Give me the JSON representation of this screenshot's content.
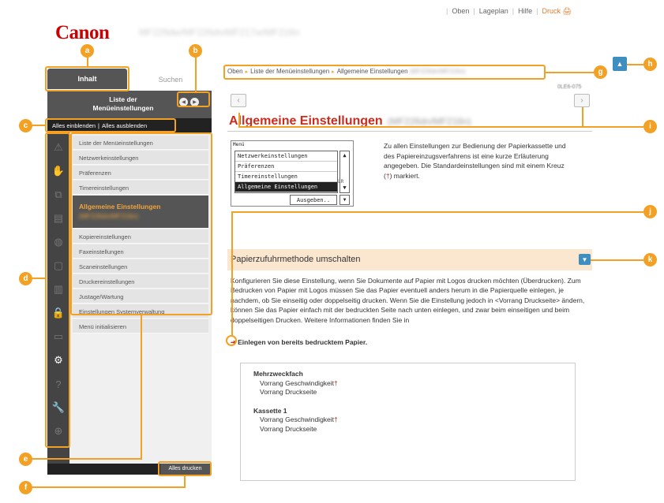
{
  "header": {
    "logo": "Canon",
    "model": "MF229dw/MF226dn/MF217w/MF216n",
    "links": [
      "Oben",
      "Lageplan",
      "Hilfe",
      "Druck"
    ]
  },
  "left": {
    "tab_contents": "Inhalt",
    "tab_search": "Suchen",
    "pane_title": "Liste der Menüeinstellungen",
    "show_all": "Alles einblenden",
    "hide_all": "Alles ausblenden",
    "menu": [
      "Liste der Menüeinstellungen",
      "Netzwerkeinstellungen",
      "Präferenzen",
      "Timereinstellungen",
      "Allgemeine Einstellungen",
      "Kopiereinstellungen",
      "Faxeinstellungen",
      "Scaneinstellungen",
      "Druckereinstellungen",
      "Justage/Wartung",
      "Einstellungen Systemverwaltung",
      "Menü initialisieren"
    ],
    "active_suffix": "(MF226dn/MF216n)",
    "print_all": "Alles drucken",
    "icons": [
      "warning-icon",
      "hand-icon",
      "machine-icon",
      "printer-icon",
      "globe-icon",
      "copy-icon",
      "scanner-icon",
      "lock-icon",
      "network-icon",
      "settings-icon",
      "help-icon",
      "wrench-icon",
      "plus-icon"
    ]
  },
  "main": {
    "breadcrumb": [
      "Oben",
      "Liste der Menüeinstellungen",
      "Allgemeine Einstellungen"
    ],
    "breadcrumb_suffix": "(MF226dn/MF216n)",
    "doc_id": "0LE6-075",
    "title": "Allgemeine Einstellungen",
    "title_suffix": "(MF226dn/MF216n)",
    "panel": {
      "label": "Menü",
      "items": [
        "Netzwerkeinstellungen",
        "Präferenzen",
        "Timereinstellungen",
        "Allgemeine Einstellungen"
      ],
      "button": "Ausgeben..",
      "lr": "LR"
    },
    "desc": "Zu allen Einstellungen zur Bedienung der Papierkassette und des Papiereinzugsverfahrens ist eine kurze Erläuterung angegeben. Die Standardeinstellungen sind mit einem Kreuz (",
    "desc_mark": "†",
    "desc_end": ") markiert.",
    "section_title": "Papierzufuhrmethode umschalten",
    "body": "Konfigurieren Sie diese Einstellung, wenn Sie Dokumente auf Papier mit Logos drucken möchten (Überdrucken). Zum Bedrucken von Papier mit Logos müssen Sie das Papier eventuell anders herum in die Papierquelle einlegen, je nachdem, ob Sie einseitig oder doppelseitig drucken. Wenn Sie die Einstellung jedoch in <Vorrang Druckseite> ändern, können Sie das Papier einfach mit der bedruckten Seite nach unten einlegen, und zwar beim einseitigen und beim doppelseitigen Drucken. Weitere Informationen finden Sie in",
    "link": "Einlegen von bereits bedrucktem Papier",
    "link_end": ".",
    "options": [
      {
        "group": "Mehrzweckfach",
        "items": [
          "Vorrang Geschwindigkeit",
          "Vorrang Druckseite"
        ]
      },
      {
        "group": "Kassette 1",
        "items": [
          "Vorrang Geschwindigkeit",
          "Vorrang Druckseite"
        ]
      }
    ],
    "default_mark": "†"
  },
  "callouts": [
    "a",
    "b",
    "c",
    "d",
    "e",
    "f",
    "g",
    "h",
    "i",
    "j",
    "k"
  ],
  "colors": {
    "accent": "#f2a124",
    "title": "#cc2b1d",
    "section": "#fbe7d0",
    "button": "#3e8fbf"
  }
}
